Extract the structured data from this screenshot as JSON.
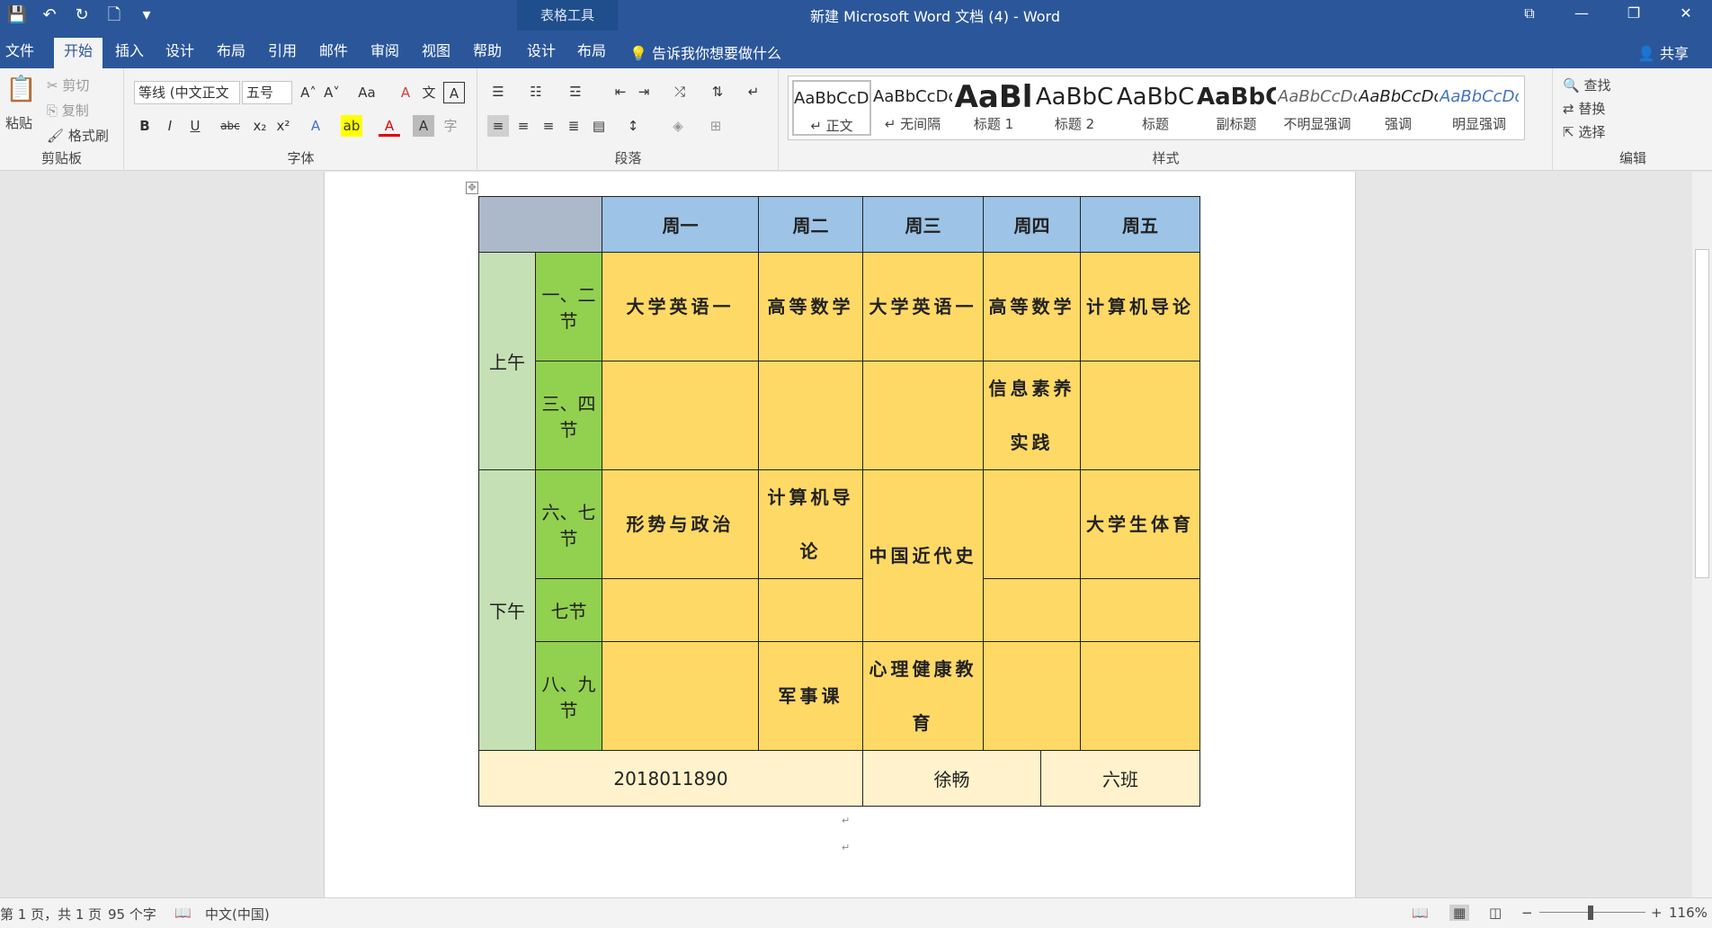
{
  "window": {
    "title": "新建 Microsoft Word 文档 (4)  -  Word",
    "context_tab_group": "表格工具",
    "buttons": {
      "ribbon_display": "⧉",
      "minimize": "—",
      "restore": "❐",
      "close": "✕"
    }
  },
  "qat": {
    "save": "💾",
    "undo": "↶",
    "redo": "↻",
    "new": "🗋",
    "customize": "▾"
  },
  "tabs": [
    "文件",
    "开始",
    "插入",
    "设计",
    "布局",
    "引用",
    "邮件",
    "审阅",
    "视图",
    "帮助",
    "设计",
    "布局"
  ],
  "tell_me": "告诉我你想要做什么",
  "share": "共享",
  "ribbon": {
    "clipboard": {
      "paste": "粘贴",
      "cut": "剪切",
      "copy": "复制",
      "format_painter": "格式刷",
      "label": "剪贴板"
    },
    "font": {
      "font_name": "等线 (中文正文",
      "font_size": "五号",
      "grow": "A˄",
      "shrink": "A˅",
      "case": "Aa",
      "clear": "A",
      "phonetic": "文",
      "border": "A",
      "bold": "B",
      "italic": "I",
      "underline": "U",
      "strike": "abc",
      "sub": "x₂",
      "sup": "x²",
      "effects": "A",
      "highlight": "ab",
      "color": "A",
      "shade": "A",
      "enclose": "字",
      "label": "字体"
    },
    "paragraph": {
      "label": "段落"
    },
    "styles": {
      "items": [
        {
          "preview": "AaBbCcDc",
          "name": "↵ 正文"
        },
        {
          "preview": "AaBbCcDc",
          "name": "↵ 无间隔"
        },
        {
          "preview": "AaBl",
          "name": "标题 1"
        },
        {
          "preview": "AaBbC",
          "name": "标题 2"
        },
        {
          "preview": "AaBbC",
          "name": "标题"
        },
        {
          "preview": "AaBbC",
          "name": "副标题"
        },
        {
          "preview": "AaBbCcDo",
          "name": "不明显强调"
        },
        {
          "preview": "AaBbCcDo",
          "name": "强调"
        },
        {
          "preview": "AaBbCcDo",
          "name": "明显强调"
        }
      ],
      "label": "样式"
    },
    "editing": {
      "find": "查找",
      "replace": "替换",
      "select": "选择",
      "label": "编辑"
    }
  },
  "timetable": {
    "headers": [
      "周一",
      "周二",
      "周三",
      "周四",
      "周五"
    ],
    "morning": "上午",
    "afternoon": "下午",
    "sessions": [
      "一、二节",
      "三、四节",
      "六、七节",
      "七节",
      "八、九节"
    ],
    "cells": {
      "r1": [
        "大学英语一",
        "高等数学",
        "大学英语一",
        "高等数学",
        "计算机导论"
      ],
      "r2": [
        "",
        "",
        "",
        "信息素养实践",
        ""
      ],
      "r3": [
        "形势与政治",
        "计算机导论",
        "中国近代史",
        "",
        "大学生体育"
      ],
      "r4": [
        "",
        "",
        "",
        ""
      ],
      "r5": [
        "",
        "军事课",
        "心理健康教育",
        "",
        ""
      ]
    },
    "footer": [
      "2018011890",
      "徐畅",
      "六班"
    ],
    "colors": {
      "header": "#9dc3e6",
      "corner": "#acb9ca",
      "period": "#c5e0b4",
      "session": "#92d050",
      "course": "#ffd966",
      "footer": "#fff2cc"
    }
  },
  "status": {
    "page": "第 1 页，共 1 页",
    "words": "95 个字",
    "language": "中文(中国)",
    "zoom": "116%"
  }
}
